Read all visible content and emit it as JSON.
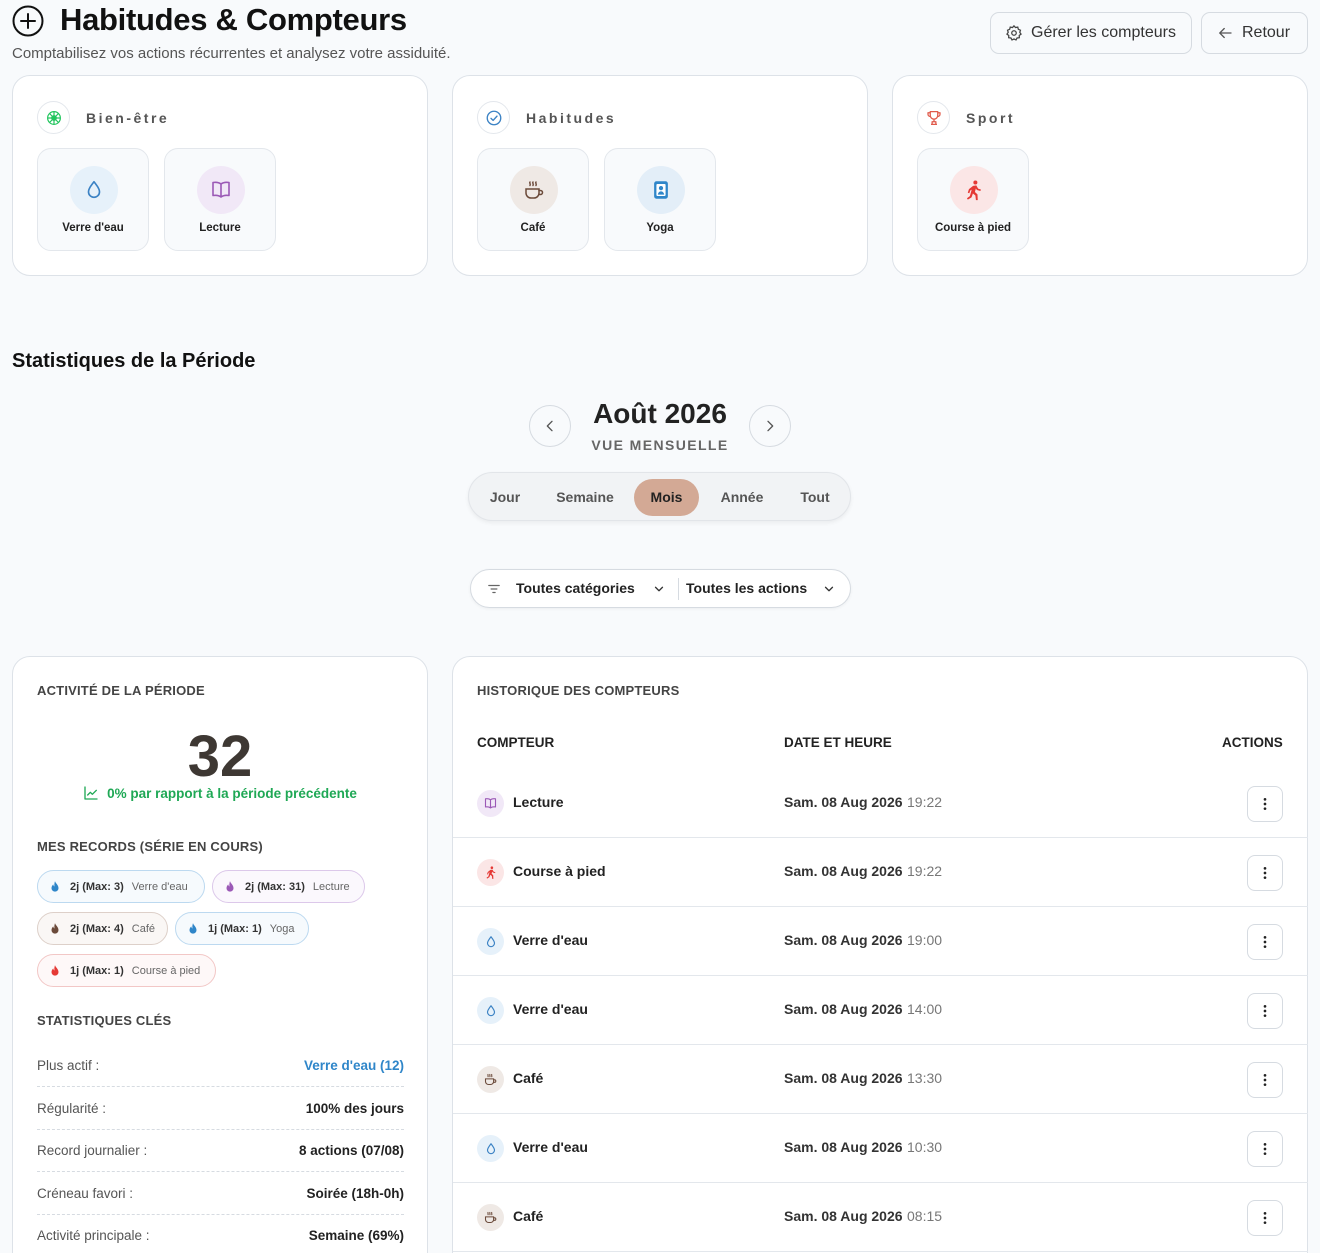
{
  "header": {
    "title": "Habitudes & Compteurs",
    "subtitle": "Comptabilisez vos actions récurrentes et analysez votre assiduité.",
    "manage_label": "Gérer les compteurs",
    "back_label": "Retour"
  },
  "categories": [
    {
      "name": "Bien-être",
      "icon": "flower-icon",
      "color": "#22c55e",
      "counters": [
        {
          "label": "Verre d'eau",
          "icon": "water-drop-icon",
          "color": "#3b82c4"
        },
        {
          "label": "Lecture",
          "icon": "book-icon",
          "color": "#9b59b6"
        }
      ]
    },
    {
      "name": "Habitudes",
      "icon": "check-circle-icon",
      "color": "#3b82c4",
      "counters": [
        {
          "label": "Café",
          "icon": "coffee-icon",
          "color": "#6b4a3a"
        },
        {
          "label": "Yoga",
          "icon": "badge-icon",
          "color": "#2f86c9"
        }
      ]
    },
    {
      "name": "Sport",
      "icon": "trophy-icon",
      "color": "#e05a4b",
      "counters": [
        {
          "label": "Course à pied",
          "icon": "runner-icon",
          "color": "#e53935"
        }
      ]
    }
  ],
  "stats": {
    "title": "Statistiques de la Période",
    "period_title": "Août 2026",
    "period_sub": "VUE MENSUELLE",
    "segments": [
      "Jour",
      "Semaine",
      "Mois",
      "Année",
      "Tout"
    ],
    "active_segment": "Mois",
    "filter_category": "Toutes catégories",
    "filter_action": "Toutes les actions"
  },
  "activity": {
    "heading": "ACTIVITÉ DE LA PÉRIODE",
    "total": "32",
    "trend": "0% par rapport à la période précédente",
    "records_heading": "MES RECORDS (SÉRIE EN COURS)",
    "records": [
      {
        "value": "2j (Max: 3)",
        "name": "Verre d'eau",
        "color": "#3b82c4"
      },
      {
        "value": "2j (Max: 31)",
        "name": "Lecture",
        "color": "#9b59b6"
      },
      {
        "value": "2j (Max: 4)",
        "name": "Café",
        "color": "#6b4a3a"
      },
      {
        "value": "1j (Max: 1)",
        "name": "Yoga",
        "color": "#2f86c9"
      },
      {
        "value": "1j (Max: 1)",
        "name": "Course à pied",
        "color": "#e53935"
      }
    ],
    "key_heading": "STATISTIQUES CLÉS",
    "key_stats": [
      {
        "label": "Plus actif :",
        "value": "Verre d'eau (12)"
      },
      {
        "label": "Régularité :",
        "value": "100% des jours"
      },
      {
        "label": "Record journalier :",
        "value": "8 actions (07/08)"
      },
      {
        "label": "Créneau favori :",
        "value": "Soirée (18h-0h)"
      },
      {
        "label": "Activité principale :",
        "value": "Semaine (69%)"
      }
    ]
  },
  "history": {
    "heading": "HISTORIQUE DES COMPTEURS",
    "col_counter": "COMPTEUR",
    "col_datetime": "DATE ET HEURE",
    "col_actions": "ACTIONS",
    "rows": [
      {
        "name": "Lecture",
        "date": "Sam. 08 Aug 2026",
        "time": "19:22",
        "icon": "book-icon"
      },
      {
        "name": "Course à pied",
        "date": "Sam. 08 Aug 2026",
        "time": "19:22",
        "icon": "runner-icon"
      },
      {
        "name": "Verre d'eau",
        "date": "Sam. 08 Aug 2026",
        "time": "19:00",
        "icon": "water-drop-icon"
      },
      {
        "name": "Verre d'eau",
        "date": "Sam. 08 Aug 2026",
        "time": "14:00",
        "icon": "water-drop-icon"
      },
      {
        "name": "Café",
        "date": "Sam. 08 Aug 2026",
        "time": "13:30",
        "icon": "coffee-icon"
      },
      {
        "name": "Verre d'eau",
        "date": "Sam. 08 Aug 2026",
        "time": "10:30",
        "icon": "water-drop-icon"
      },
      {
        "name": "Café",
        "date": "Sam. 08 Aug 2026",
        "time": "08:15",
        "icon": "coffee-icon"
      }
    ]
  }
}
